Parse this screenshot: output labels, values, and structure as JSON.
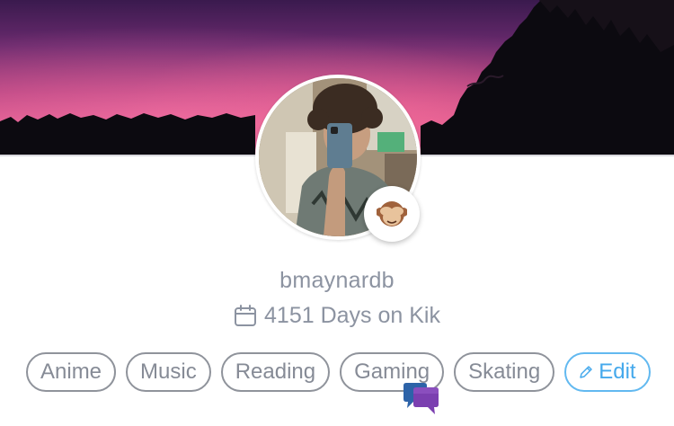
{
  "profile": {
    "username": "bmaynardb",
    "days_on_kik": "4151 Days on Kik",
    "calendar_icon": "calendar-icon",
    "status_emoji": "see-no-evil-monkey-emoji"
  },
  "interests": [
    {
      "label": "Anime"
    },
    {
      "label": "Music"
    },
    {
      "label": "Reading"
    },
    {
      "label": "Gaming"
    },
    {
      "label": "Skating"
    }
  ],
  "edit": {
    "label": "Edit",
    "icon": "pencil-icon"
  },
  "colors": {
    "text_muted": "#8c93a1",
    "accent_edit": "#45a9ec",
    "chat_bubble_purple": "#7b3fb0",
    "chat_bubble_blue": "#2d63a8"
  }
}
